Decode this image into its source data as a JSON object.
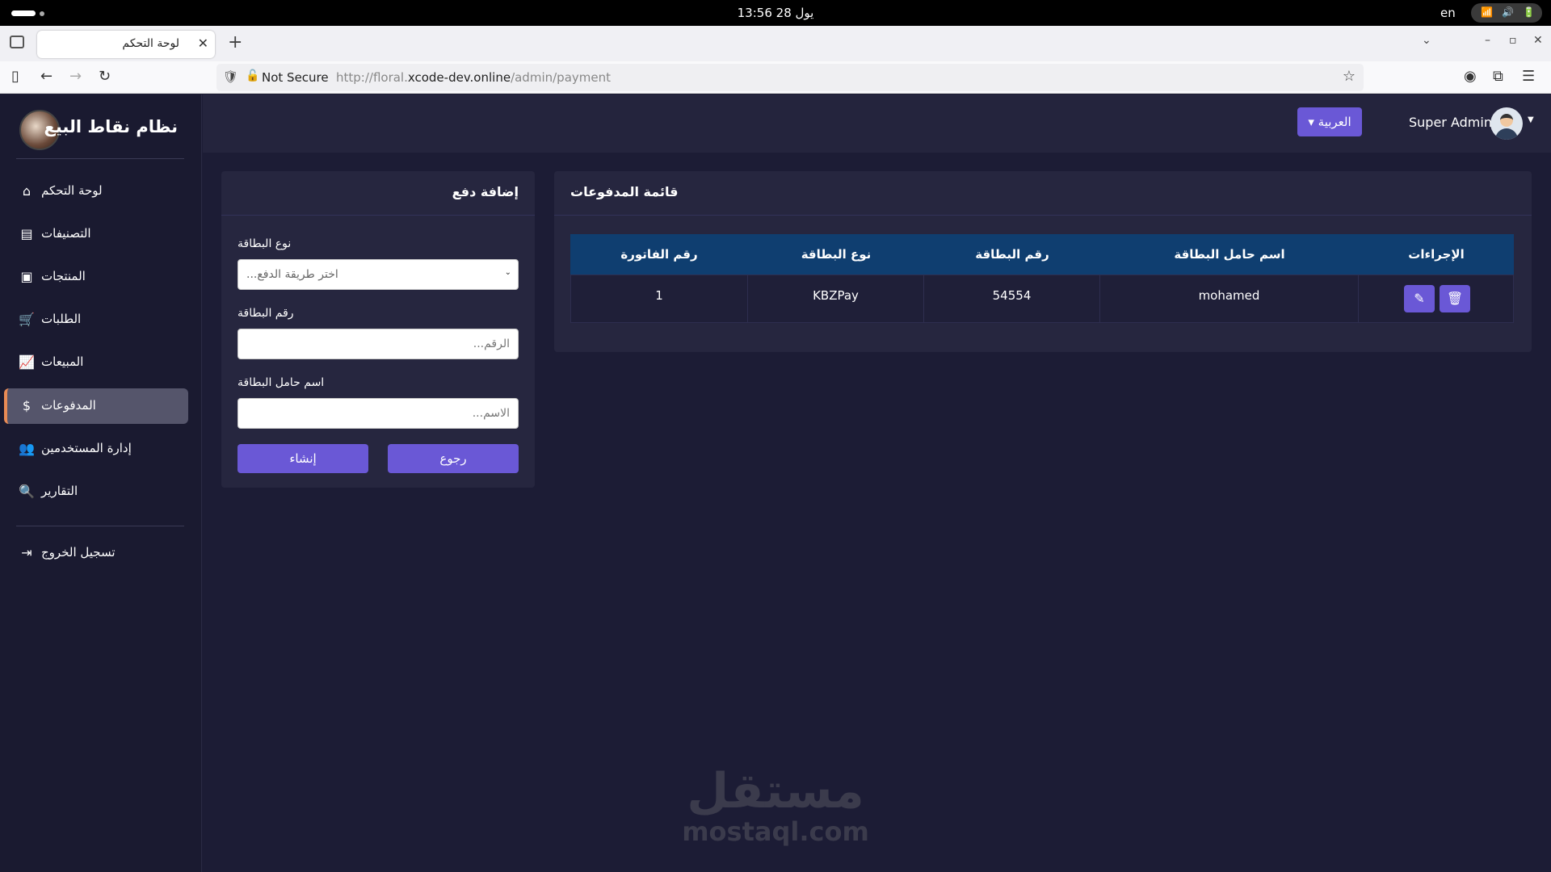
{
  "os": {
    "clock": "يول 28  13:56",
    "lang": "en"
  },
  "browser": {
    "tab_title": "لوحة التحكم",
    "security": "Not Secure",
    "url_prefix": "http://floral.",
    "url_domain": "xcode-dev.online",
    "url_path": "/admin/payment"
  },
  "app": {
    "brand": "نظام نقاط البيع",
    "language": "العربية",
    "user": "Super Admin",
    "nav": [
      {
        "label": "لوحة التحكم",
        "icon": "home-icon"
      },
      {
        "label": "التصنيفات",
        "icon": "table-icon"
      },
      {
        "label": "المنتجات",
        "icon": "box-icon"
      },
      {
        "label": "الطلبات",
        "icon": "cart-icon"
      },
      {
        "label": "المبيعات",
        "icon": "chart-line-icon"
      },
      {
        "label": "المدفوعات",
        "icon": "dollar-icon"
      },
      {
        "label": "إدارة المستخدمين",
        "icon": "users-icon"
      },
      {
        "label": "التقارير",
        "icon": "search-icon"
      }
    ],
    "logout": "تسجيل الخروج",
    "active_nav": "المدفوعات",
    "accent": "#6a58d6",
    "table_header_bg": "#0f3e70"
  },
  "form": {
    "title": "إضافة دفع",
    "card_type_label": "نوع البطاقة",
    "card_type_placeholder": "اختر طريقة الدفع...",
    "card_number_label": "رقم البطاقة",
    "card_number_placeholder": "الرقم...",
    "holder_label": "اسم حامل البطاقة",
    "holder_placeholder": "الاسم...",
    "create": "إنشاء",
    "back": "رجوع"
  },
  "list": {
    "title": "قائمة المدفوعات",
    "columns": [
      "الإجراءات",
      "اسم حامل البطاقة",
      "رقم البطاقة",
      "نوع البطاقة",
      "رقم الفاتورة"
    ],
    "rows": [
      {
        "holder": "mohamed",
        "number": "54554",
        "type": "KBZPay",
        "invoice": "1"
      }
    ]
  },
  "watermark": {
    "ar": "مستقل",
    "en": "mostaql.com"
  }
}
